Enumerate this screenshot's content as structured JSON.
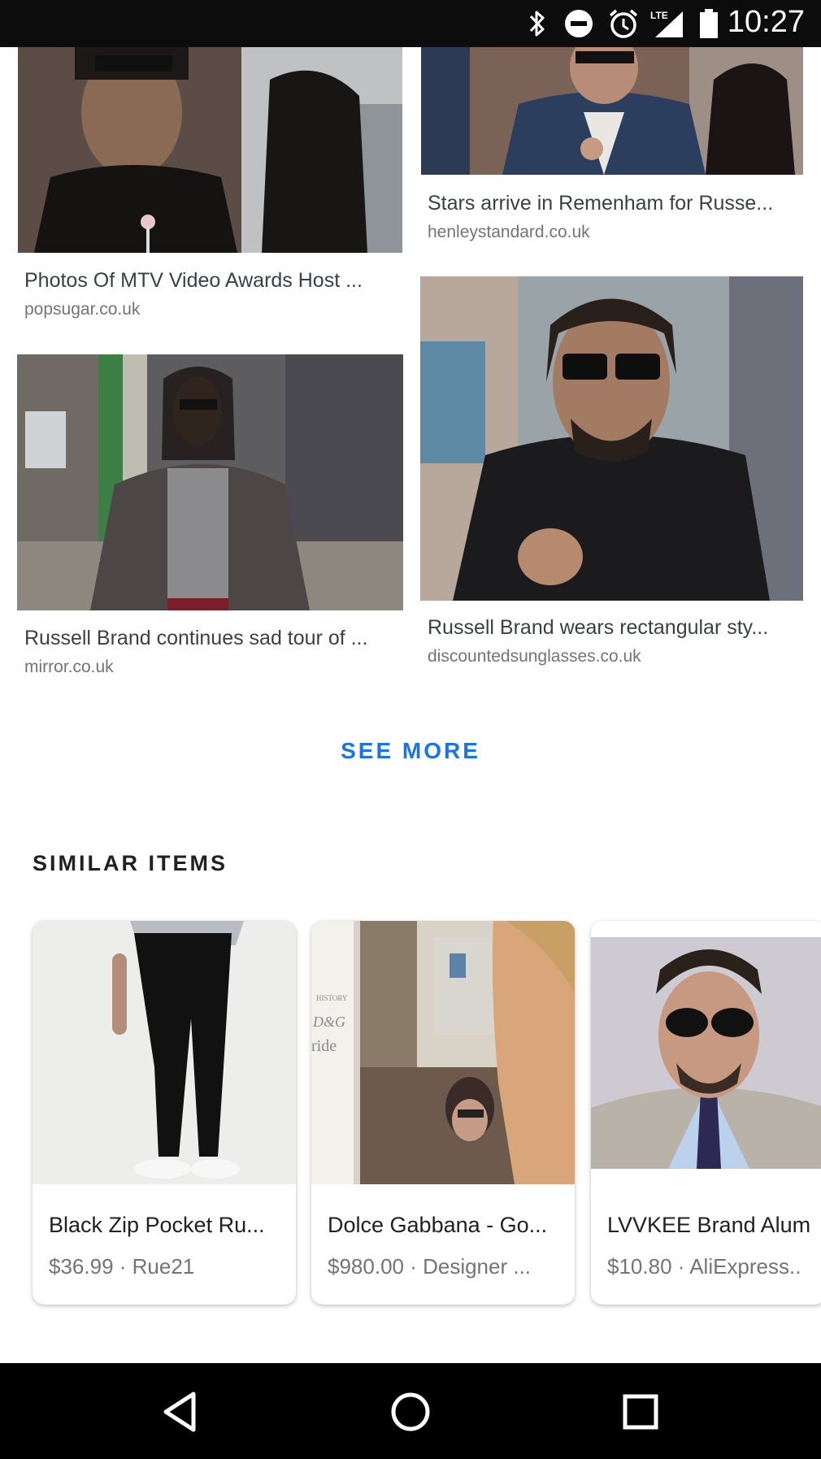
{
  "status_bar": {
    "time": "10:27",
    "network": "LTE",
    "icons": [
      "bluetooth-icon",
      "do-not-disturb-icon",
      "alarm-icon",
      "signal-icon",
      "battery-icon"
    ]
  },
  "image_results": [
    {
      "title": "Photos Of MTV Video Awards Host ...",
      "source": "popsugar.co.uk"
    },
    {
      "title": "Stars arrive in Remenham for Russe...",
      "source": "henleystandard.co.uk"
    },
    {
      "title": "Russell Brand continues sad tour of ...",
      "source": "mirror.co.uk"
    },
    {
      "title": "Russell Brand wears rectangular sty...",
      "source": "discountedsunglasses.co.uk"
    }
  ],
  "see_more_label": "SEE MORE",
  "similar_items": {
    "heading": "SIMILAR ITEMS",
    "items": [
      {
        "title": "Black Zip Pocket Ru...",
        "price": "$36.99",
        "store": "Rue21",
        "meta": "$36.99 · Rue21"
      },
      {
        "title": "Dolce Gabbana - Go...",
        "price": "$980.00",
        "store": "Designer ...",
        "meta": "$980.00 · Designer ..."
      },
      {
        "title": "LVVKEE Brand Alum",
        "price": "$10.80",
        "store": "AliExpress..",
        "meta": "$10.80 · AliExpress.."
      }
    ]
  },
  "photo_caption_text": [
    "HISTORY",
    "D&G",
    "ride"
  ],
  "nav_bar": {
    "buttons": [
      "back-icon",
      "home-icon",
      "recents-icon"
    ]
  },
  "colors": {
    "accent": "#1a73e8",
    "status_bar_bg": "#0c0c0c",
    "nav_bar_bg": "#000000",
    "title_text": "#3c4043",
    "secondary_text": "#70757a"
  }
}
